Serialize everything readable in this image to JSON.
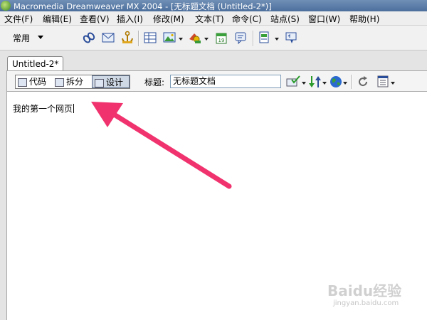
{
  "window": {
    "title": "Macromedia Dreamweaver MX 2004 - [无标题文档 (Untitled-2*)]"
  },
  "menu": [
    "文件(F)",
    "编辑(E)",
    "查看(V)",
    "插入(I)",
    "修改(M)",
    "文本(T)",
    "命令(C)",
    "站点(S)",
    "窗口(W)",
    "帮助(H)"
  ],
  "insert_bar": {
    "category": "常用",
    "icons": [
      "hyperlink-icon",
      "email-link-icon",
      "named-anchor-icon",
      "table-icon",
      "image-icon",
      "media-icon",
      "date-icon",
      "comment-icon",
      "template-icon",
      "tag-chooser-icon"
    ]
  },
  "document": {
    "tab_label": "Untitled-2*",
    "views": {
      "code": "代码",
      "split": "拆分",
      "design": "设计"
    },
    "title_label": "标题:",
    "title_value": "无标题文档",
    "content": "我的第一个网页"
  },
  "watermark": {
    "main": "Baidu经验",
    "sub": "jingyan.baidu.com"
  },
  "colors": {
    "arrow": "#f0336e",
    "titlebar": "#5a7aa6",
    "active_view": "#cfd9e6"
  }
}
